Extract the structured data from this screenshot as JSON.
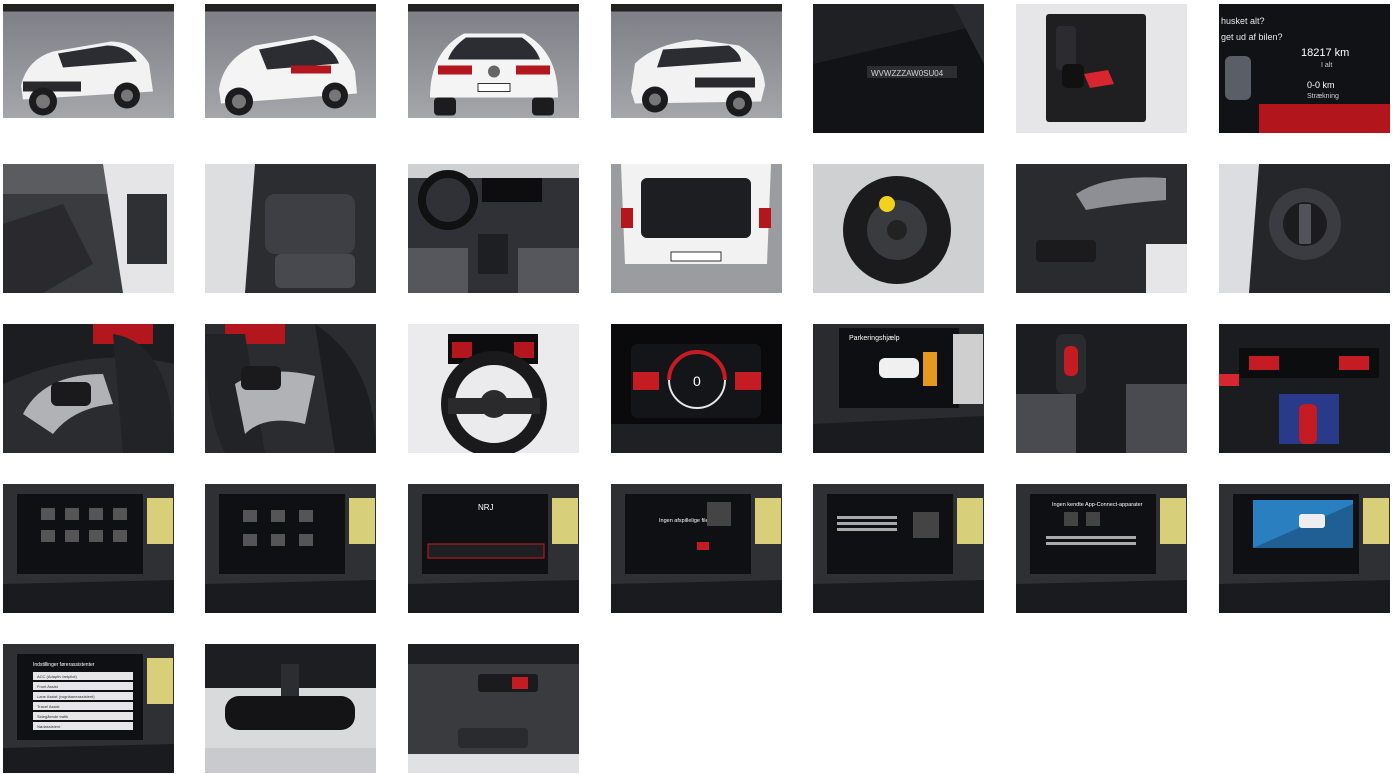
{
  "gallery": {
    "photos": [
      {
        "name": "car-front-three-quarter-photo"
      },
      {
        "name": "car-rear-three-quarter-photo"
      },
      {
        "name": "car-rear-photo"
      },
      {
        "name": "car-front-right-photo"
      },
      {
        "name": "vin-windshield-photo"
      },
      {
        "name": "car-keys-photo"
      },
      {
        "name": "dashboard-odometer-photo"
      },
      {
        "name": "front-interior-door-photo"
      },
      {
        "name": "rear-seats-photo"
      },
      {
        "name": "cockpit-overview-photo"
      },
      {
        "name": "open-trunk-photo"
      },
      {
        "name": "spare-wheel-photo"
      },
      {
        "name": "door-handle-window-switch-photo"
      },
      {
        "name": "light-switch-photo"
      },
      {
        "name": "steering-wheel-left-buttons-photo"
      },
      {
        "name": "steering-wheel-right-buttons-photo"
      },
      {
        "name": "steering-wheel-photo"
      },
      {
        "name": "digital-cockpit-photo"
      },
      {
        "name": "parking-sensor-screen-photo"
      },
      {
        "name": "gear-lever-seats-photo"
      },
      {
        "name": "climate-panel-gear-photo"
      },
      {
        "name": "infotainment-menu-photo"
      },
      {
        "name": "infotainment-menu-2-photo"
      },
      {
        "name": "infotainment-radio-photo"
      },
      {
        "name": "infotainment-media-photo"
      },
      {
        "name": "infotainment-phone-photo"
      },
      {
        "name": "infotainment-app-connect-photo"
      },
      {
        "name": "infotainment-driver-assist-photo"
      },
      {
        "name": "infotainment-settings-photo"
      },
      {
        "name": "rearview-mirror-photo"
      },
      {
        "name": "overhead-console-photo"
      }
    ],
    "captions": {
      "vin": "WVWZZZAW0SU04",
      "odo_q1": "husket alt?",
      "odo_q2": "get ud af bilen?",
      "odo_km": "18217 km",
      "odo_ialt": "I alt",
      "odo_trip": "0-0 km",
      "odo_strk": "Strækning",
      "cockpit_speed": "0",
      "park_title": "Parkeringshjælp",
      "radio_station": "NRJ",
      "media_text": "Ingen afspillelige filer",
      "appconnect_title": "Ingen kendte App-Connect-apparater",
      "settings_title": "Indstillinger førerassistenter",
      "settings_items": [
        "ACC (Adaptiv fartpilot)",
        "Front Assist",
        "Lane Assist (vognbaneassistent)",
        "Travel Assist",
        "Sidegående trafik",
        "Nødassistent"
      ]
    }
  }
}
